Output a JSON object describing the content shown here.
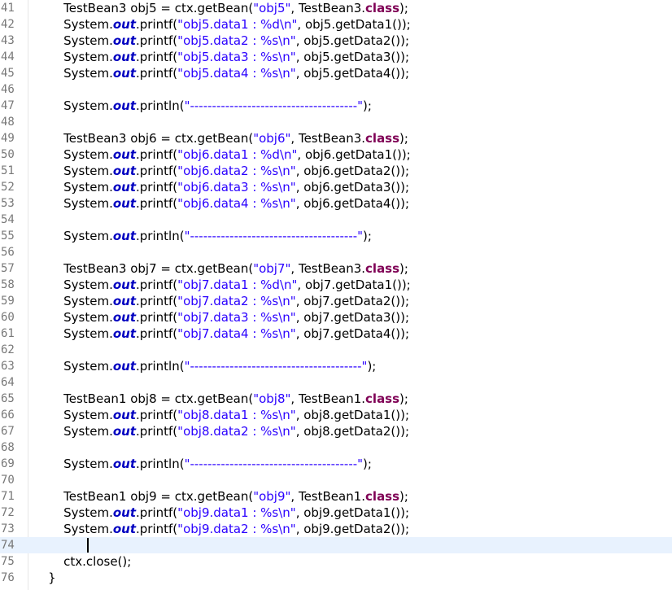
{
  "editor": {
    "colors": {
      "keyword": "#7f0055",
      "field": "#0000c0",
      "string": "#2a00ff",
      "line_number": "#787878",
      "current_line": "#e8f2fe"
    },
    "current_line": 74,
    "lines": [
      {
        "n": "41",
        "segs": [
          [
            "t",
            "        TestBean3 obj5 = ctx.getBean("
          ],
          [
            "s",
            "\"obj5\""
          ],
          [
            "t",
            ", TestBean3."
          ],
          [
            "k",
            "class"
          ],
          [
            "t",
            ");"
          ]
        ]
      },
      {
        "n": "42",
        "segs": [
          [
            "t",
            "        System."
          ],
          [
            "f",
            "out"
          ],
          [
            "t",
            ".printf("
          ],
          [
            "s",
            "\"obj5.data1 : %d\\n\""
          ],
          [
            "t",
            ", obj5.getData1());"
          ]
        ]
      },
      {
        "n": "43",
        "segs": [
          [
            "t",
            "        System."
          ],
          [
            "f",
            "out"
          ],
          [
            "t",
            ".printf("
          ],
          [
            "s",
            "\"obj5.data2 : %s\\n\""
          ],
          [
            "t",
            ", obj5.getData2());"
          ]
        ]
      },
      {
        "n": "44",
        "segs": [
          [
            "t",
            "        System."
          ],
          [
            "f",
            "out"
          ],
          [
            "t",
            ".printf("
          ],
          [
            "s",
            "\"obj5.data3 : %s\\n\""
          ],
          [
            "t",
            ", obj5.getData3());"
          ]
        ]
      },
      {
        "n": "45",
        "segs": [
          [
            "t",
            "        System."
          ],
          [
            "f",
            "out"
          ],
          [
            "t",
            ".printf("
          ],
          [
            "s",
            "\"obj5.data4 : %s\\n\""
          ],
          [
            "t",
            ", obj5.getData4());"
          ]
        ]
      },
      {
        "n": "46",
        "segs": []
      },
      {
        "n": "47",
        "segs": [
          [
            "t",
            "        System."
          ],
          [
            "f",
            "out"
          ],
          [
            "t",
            ".println("
          ],
          [
            "s",
            "\"--------------------------------------\""
          ],
          [
            "t",
            ");"
          ]
        ]
      },
      {
        "n": "48",
        "segs": []
      },
      {
        "n": "49",
        "segs": [
          [
            "t",
            "        TestBean3 obj6 = ctx.getBean("
          ],
          [
            "s",
            "\"obj6\""
          ],
          [
            "t",
            ", TestBean3."
          ],
          [
            "k",
            "class"
          ],
          [
            "t",
            ");"
          ]
        ]
      },
      {
        "n": "50",
        "segs": [
          [
            "t",
            "        System."
          ],
          [
            "f",
            "out"
          ],
          [
            "t",
            ".printf("
          ],
          [
            "s",
            "\"obj6.data1 : %d\\n\""
          ],
          [
            "t",
            ", obj6.getData1());"
          ]
        ]
      },
      {
        "n": "51",
        "segs": [
          [
            "t",
            "        System."
          ],
          [
            "f",
            "out"
          ],
          [
            "t",
            ".printf("
          ],
          [
            "s",
            "\"obj6.data2 : %s\\n\""
          ],
          [
            "t",
            ", obj6.getData2());"
          ]
        ]
      },
      {
        "n": "52",
        "segs": [
          [
            "t",
            "        System."
          ],
          [
            "f",
            "out"
          ],
          [
            "t",
            ".printf("
          ],
          [
            "s",
            "\"obj6.data3 : %s\\n\""
          ],
          [
            "t",
            ", obj6.getData3());"
          ]
        ]
      },
      {
        "n": "53",
        "segs": [
          [
            "t",
            "        System."
          ],
          [
            "f",
            "out"
          ],
          [
            "t",
            ".printf("
          ],
          [
            "s",
            "\"obj6.data4 : %s\\n\""
          ],
          [
            "t",
            ", obj6.getData4());"
          ]
        ]
      },
      {
        "n": "54",
        "segs": []
      },
      {
        "n": "55",
        "segs": [
          [
            "t",
            "        System."
          ],
          [
            "f",
            "out"
          ],
          [
            "t",
            ".println("
          ],
          [
            "s",
            "\"--------------------------------------\""
          ],
          [
            "t",
            ");"
          ]
        ]
      },
      {
        "n": "56",
        "segs": []
      },
      {
        "n": "57",
        "segs": [
          [
            "t",
            "        TestBean3 obj7 = ctx.getBean("
          ],
          [
            "s",
            "\"obj7\""
          ],
          [
            "t",
            ", TestBean3."
          ],
          [
            "k",
            "class"
          ],
          [
            "t",
            ");"
          ]
        ]
      },
      {
        "n": "58",
        "segs": [
          [
            "t",
            "        System."
          ],
          [
            "f",
            "out"
          ],
          [
            "t",
            ".printf("
          ],
          [
            "s",
            "\"obj7.data1 : %d\\n\""
          ],
          [
            "t",
            ", obj7.getData1());"
          ]
        ]
      },
      {
        "n": "59",
        "segs": [
          [
            "t",
            "        System."
          ],
          [
            "f",
            "out"
          ],
          [
            "t",
            ".printf("
          ],
          [
            "s",
            "\"obj7.data2 : %s\\n\""
          ],
          [
            "t",
            ", obj7.getData2());"
          ]
        ]
      },
      {
        "n": "60",
        "segs": [
          [
            "t",
            "        System."
          ],
          [
            "f",
            "out"
          ],
          [
            "t",
            ".printf("
          ],
          [
            "s",
            "\"obj7.data3 : %s\\n\""
          ],
          [
            "t",
            ", obj7.getData3());"
          ]
        ]
      },
      {
        "n": "61",
        "segs": [
          [
            "t",
            "        System."
          ],
          [
            "f",
            "out"
          ],
          [
            "t",
            ".printf("
          ],
          [
            "s",
            "\"obj7.data4 : %s\\n\""
          ],
          [
            "t",
            ", obj7.getData4());"
          ]
        ]
      },
      {
        "n": "62",
        "segs": []
      },
      {
        "n": "63",
        "segs": [
          [
            "t",
            "        System."
          ],
          [
            "f",
            "out"
          ],
          [
            "t",
            ".println("
          ],
          [
            "s",
            "\"---------------------------------------\""
          ],
          [
            "t",
            ");"
          ]
        ]
      },
      {
        "n": "64",
        "segs": []
      },
      {
        "n": "65",
        "segs": [
          [
            "t",
            "        TestBean1 obj8 = ctx.getBean("
          ],
          [
            "s",
            "\"obj8\""
          ],
          [
            "t",
            ", TestBean1."
          ],
          [
            "k",
            "class"
          ],
          [
            "t",
            ");"
          ]
        ]
      },
      {
        "n": "66",
        "segs": [
          [
            "t",
            "        System."
          ],
          [
            "f",
            "out"
          ],
          [
            "t",
            ".printf("
          ],
          [
            "s",
            "\"obj8.data1 : %s\\n\""
          ],
          [
            "t",
            ", obj8.getData1());"
          ]
        ]
      },
      {
        "n": "67",
        "segs": [
          [
            "t",
            "        System."
          ],
          [
            "f",
            "out"
          ],
          [
            "t",
            ".printf("
          ],
          [
            "s",
            "\"obj8.data2 : %s\\n\""
          ],
          [
            "t",
            ", obj8.getData2());"
          ]
        ]
      },
      {
        "n": "68",
        "segs": []
      },
      {
        "n": "69",
        "segs": [
          [
            "t",
            "        System."
          ],
          [
            "f",
            "out"
          ],
          [
            "t",
            ".println("
          ],
          [
            "s",
            "\"--------------------------------------\""
          ],
          [
            "t",
            ");"
          ]
        ]
      },
      {
        "n": "70",
        "segs": []
      },
      {
        "n": "71",
        "segs": [
          [
            "t",
            "        TestBean1 obj9 = ctx.getBean("
          ],
          [
            "s",
            "\"obj9\""
          ],
          [
            "t",
            ", TestBean1."
          ],
          [
            "k",
            "class"
          ],
          [
            "t",
            ");"
          ]
        ]
      },
      {
        "n": "72",
        "segs": [
          [
            "t",
            "        System."
          ],
          [
            "f",
            "out"
          ],
          [
            "t",
            ".printf("
          ],
          [
            "s",
            "\"obj9.data1 : %s\\n\""
          ],
          [
            "t",
            ", obj9.getData1());"
          ]
        ]
      },
      {
        "n": "73",
        "segs": [
          [
            "t",
            "        System."
          ],
          [
            "f",
            "out"
          ],
          [
            "t",
            ".printf("
          ],
          [
            "s",
            "\"obj9.data2 : %s\\n\""
          ],
          [
            "t",
            ", obj9.getData2());"
          ]
        ]
      },
      {
        "n": "74",
        "segs": []
      },
      {
        "n": "75",
        "segs": [
          [
            "t",
            "        ctx.close();"
          ]
        ]
      },
      {
        "n": "76",
        "segs": [
          [
            "t",
            "    }"
          ]
        ]
      }
    ]
  }
}
